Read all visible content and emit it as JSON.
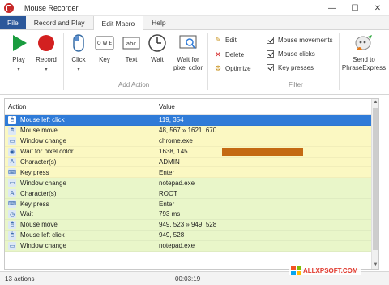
{
  "window": {
    "title": "Mouse Recorder",
    "minimize_glyph": "—",
    "maximize_glyph": "☐",
    "close_glyph": "✕"
  },
  "menu": {
    "tabs": [
      "File",
      "Record and Play",
      "Edit Macro",
      "Help"
    ],
    "active_tab": "Edit Macro"
  },
  "ribbon": {
    "play_label": "Play",
    "record_label": "Record",
    "click_label": "Click",
    "key_label": "Key",
    "text_label": "Text",
    "wait_label": "Wait",
    "wait_pixel_label_1": "Wait for",
    "wait_pixel_label_2": "pixel color",
    "edit_label": "Edit",
    "delete_label": "Delete",
    "optimize_label": "Optimize",
    "add_action_group": "Add Action",
    "filter_group": "Filter",
    "filter_mouse_movements": "Mouse movements",
    "filter_mouse_clicks": "Mouse clicks",
    "filter_key_presses": "Key presses",
    "send_label_1": "Send to",
    "send_label_2": "PhraseExpress",
    "key_icon_text": "Q W E",
    "text_icon_text": "abc"
  },
  "table": {
    "col_action": "Action",
    "col_value": "Value",
    "rows": [
      {
        "action": "Mouse left click",
        "value": "119, 354",
        "icon": "mouse-icon",
        "style": "selected"
      },
      {
        "action": "Mouse move",
        "value": "48, 567 » 1621, 670",
        "icon": "mouse-icon",
        "style": "yellow"
      },
      {
        "action": "Window change",
        "value": "chrome.exe",
        "icon": "window-icon",
        "style": "yellow"
      },
      {
        "action": "Wait for pixel color",
        "value": "1638, 145",
        "icon": "pixel-icon",
        "style": "yellow"
      },
      {
        "action": "Character(s)",
        "value": "ADMIN",
        "icon": "characters-icon",
        "style": "yellow"
      },
      {
        "action": "Key press",
        "value": "Enter",
        "icon": "keyboard-icon",
        "style": "yellow"
      },
      {
        "action": "Window change",
        "value": "notepad.exe",
        "icon": "window-icon",
        "style": "green"
      },
      {
        "action": "Character(s)",
        "value": "ROOT",
        "icon": "characters-icon",
        "style": "green"
      },
      {
        "action": "Key press",
        "value": "Enter",
        "icon": "keyboard-icon",
        "style": "green"
      },
      {
        "action": "Wait",
        "value": "793 ms",
        "icon": "clock-icon",
        "style": "green"
      },
      {
        "action": "Mouse move",
        "value": "949, 523 » 949, 528",
        "icon": "mouse-icon",
        "style": "green"
      },
      {
        "action": "Mouse left click",
        "value": "949, 528",
        "icon": "mouse-icon",
        "style": "green"
      },
      {
        "action": "Window change",
        "value": "notepad.exe",
        "icon": "window-icon",
        "style": "green"
      }
    ]
  },
  "status": {
    "count": "13 actions",
    "time": "00:03:19"
  },
  "watermark": {
    "text": "ALLXPSOFT.COM"
  },
  "colors": {
    "accent": "#2b579a",
    "selected_row": "#2f7bd8",
    "yellow_row": "#fbf8c2",
    "green_row": "#e9f6c9",
    "pixel_color_swatch": "#c46a13"
  }
}
